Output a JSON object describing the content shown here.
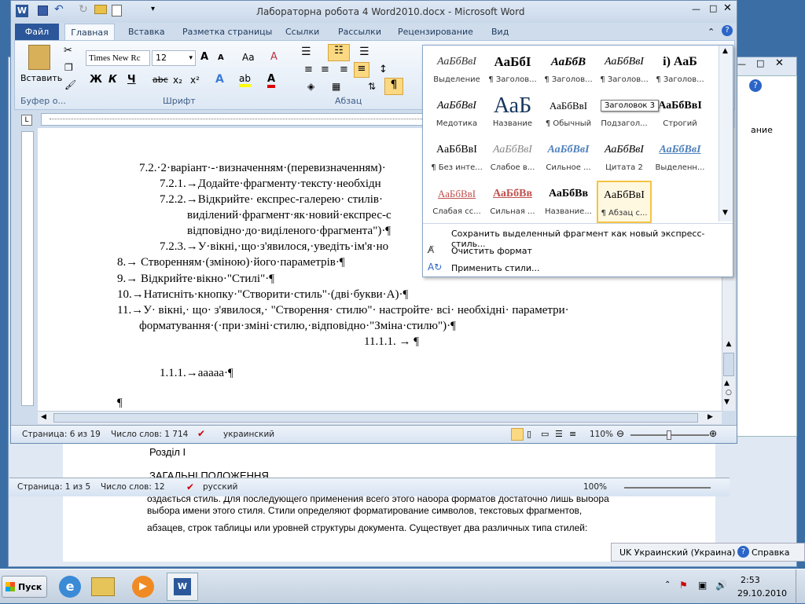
{
  "back_window": {
    "heading1": "Розділ I",
    "heading2": "ЗАГАЛЬНІ ПОЛОЖЕННЯ",
    "line_partial": "оздається стиль. Для последующего применения всего этого набора форматов достаточно лишь выбора",
    "line1": "выбора имени этого стиля. Стили определяют форматирование символов, текстовых фрагментов,",
    "line2": "абзацев, строк таблицы или уровней структуры документа. Существует два различных типа стилей:",
    "status": {
      "page": "Страница: 1 из 5",
      "words": "Число слов: 12",
      "lang": "русский",
      "zoom": "100%"
    },
    "side_text": "ание"
  },
  "window": {
    "title": "Лабораторна робота 4 Word2010.docx - Microsoft Word"
  },
  "ribbon": {
    "tabs": [
      "Файл",
      "Главная",
      "Вставка",
      "Разметка страницы",
      "Ссылки",
      "Рассылки",
      "Рецензирование",
      "Вид"
    ],
    "paste_label": "Вставить",
    "font_name": "Times New Rc",
    "font_size": "12",
    "groups": {
      "clipboard": "Буфер о...",
      "font": "Шрифт",
      "paragraph": "Абзац"
    },
    "format_buttons": [
      "Ж",
      "К",
      "Ч",
      "abc",
      "x₂",
      "x²"
    ]
  },
  "styles_gallery": {
    "items": [
      {
        "preview": "АаБбВвІ",
        "label": "Выделение"
      },
      {
        "preview": "АаБбІ",
        "label": "¶ Заголов..."
      },
      {
        "preview": "АаБбВ",
        "label": "¶ Заголов..."
      },
      {
        "preview": "АаБбВвІ",
        "label": "¶ Заголов..."
      },
      {
        "preview": "i) АаБ",
        "label": "¶ Заголов..."
      },
      {
        "preview": "АаБбВвІ",
        "label": "Медотика"
      },
      {
        "preview": "АаБ",
        "label": "Название"
      },
      {
        "preview": "АаБбВвІ",
        "label": "¶ Обычный"
      },
      {
        "preview": "АаБбВвІ",
        "label": "Подзагол..."
      },
      {
        "preview": "АаБбВвІ",
        "label": "Строгий"
      },
      {
        "preview": "АаБбВвІ",
        "label": "¶ Без инте..."
      },
      {
        "preview": "АаБбВвІ",
        "label": "Слабое в..."
      },
      {
        "preview": "АаБбВвІ",
        "label": "Сильное ..."
      },
      {
        "preview": "АаБбВвІ",
        "label": "Цитата 2"
      },
      {
        "preview": "АаБбВвІ",
        "label": "Выделенн..."
      },
      {
        "preview": "АаБбВвІ",
        "label": "Слабая сс..."
      },
      {
        "preview": "АаБбВв",
        "label": "Сильная ..."
      },
      {
        "preview": "АаБбВв",
        "label": "Название..."
      },
      {
        "preview": "АаБбВвІ",
        "label": "¶ Абзац с..."
      }
    ],
    "tooltip": "Заголовок 3",
    "menu": [
      "Сохранить выделенный фрагмент как новый экспресс-стиль...",
      "Очистить формат",
      "Применить стили..."
    ]
  },
  "document": {
    "lines": [
      "7.2.·2·варіант·-·визначенням·(перевизначенням)·",
      "7.2.1.→Додайте·фрагменту·тексту·необхідн",
      "7.2.2.→Відкрийте·  експрес-галерею·  стилів·",
      "виділений·фрагмент·як·новий·експрес-с",
      "відповідно·до·виділеного·фрагмента\")·¶",
      "7.2.3.→У·вікні,·що·з'явилося,·уведіть·ім'я·но",
      "8.→ Створенням·(зміною)·його·параметрів·¶",
      "9.→ Відкрийте·вікно·\"Стилі\"·¶",
      "10.→Натисніть·кнопку·\"Створити·стиль\"·(дві·букви·А)·¶",
      "11.→У·  вікні,·  що·  з'явилося,·  \"Створення·  стилю\"·  настройте·  всі·  необхідні·  параметри·",
      "форматування·(·при·зміні·стилю,·відповідно·\"Зміна·стилю\")·¶",
      "11.1.1.   →   ¶",
      "1.1.1.→ааааа·¶",
      "¶"
    ]
  },
  "status_bar": {
    "page": "Страница: 6 из 19",
    "words": "Число слов: 1 714",
    "lang": "украинский",
    "zoom": "110%"
  },
  "language_bar": {
    "lang": "UK Украинский (Украина)",
    "help": "Справка"
  },
  "taskbar": {
    "start": "Пуск",
    "time": "2:53",
    "date": "29.10.2010"
  },
  "colors": {
    "accent": "#2b579a",
    "gallery_selected": "#f6c342",
    "desktop": "#3a6ea5"
  }
}
